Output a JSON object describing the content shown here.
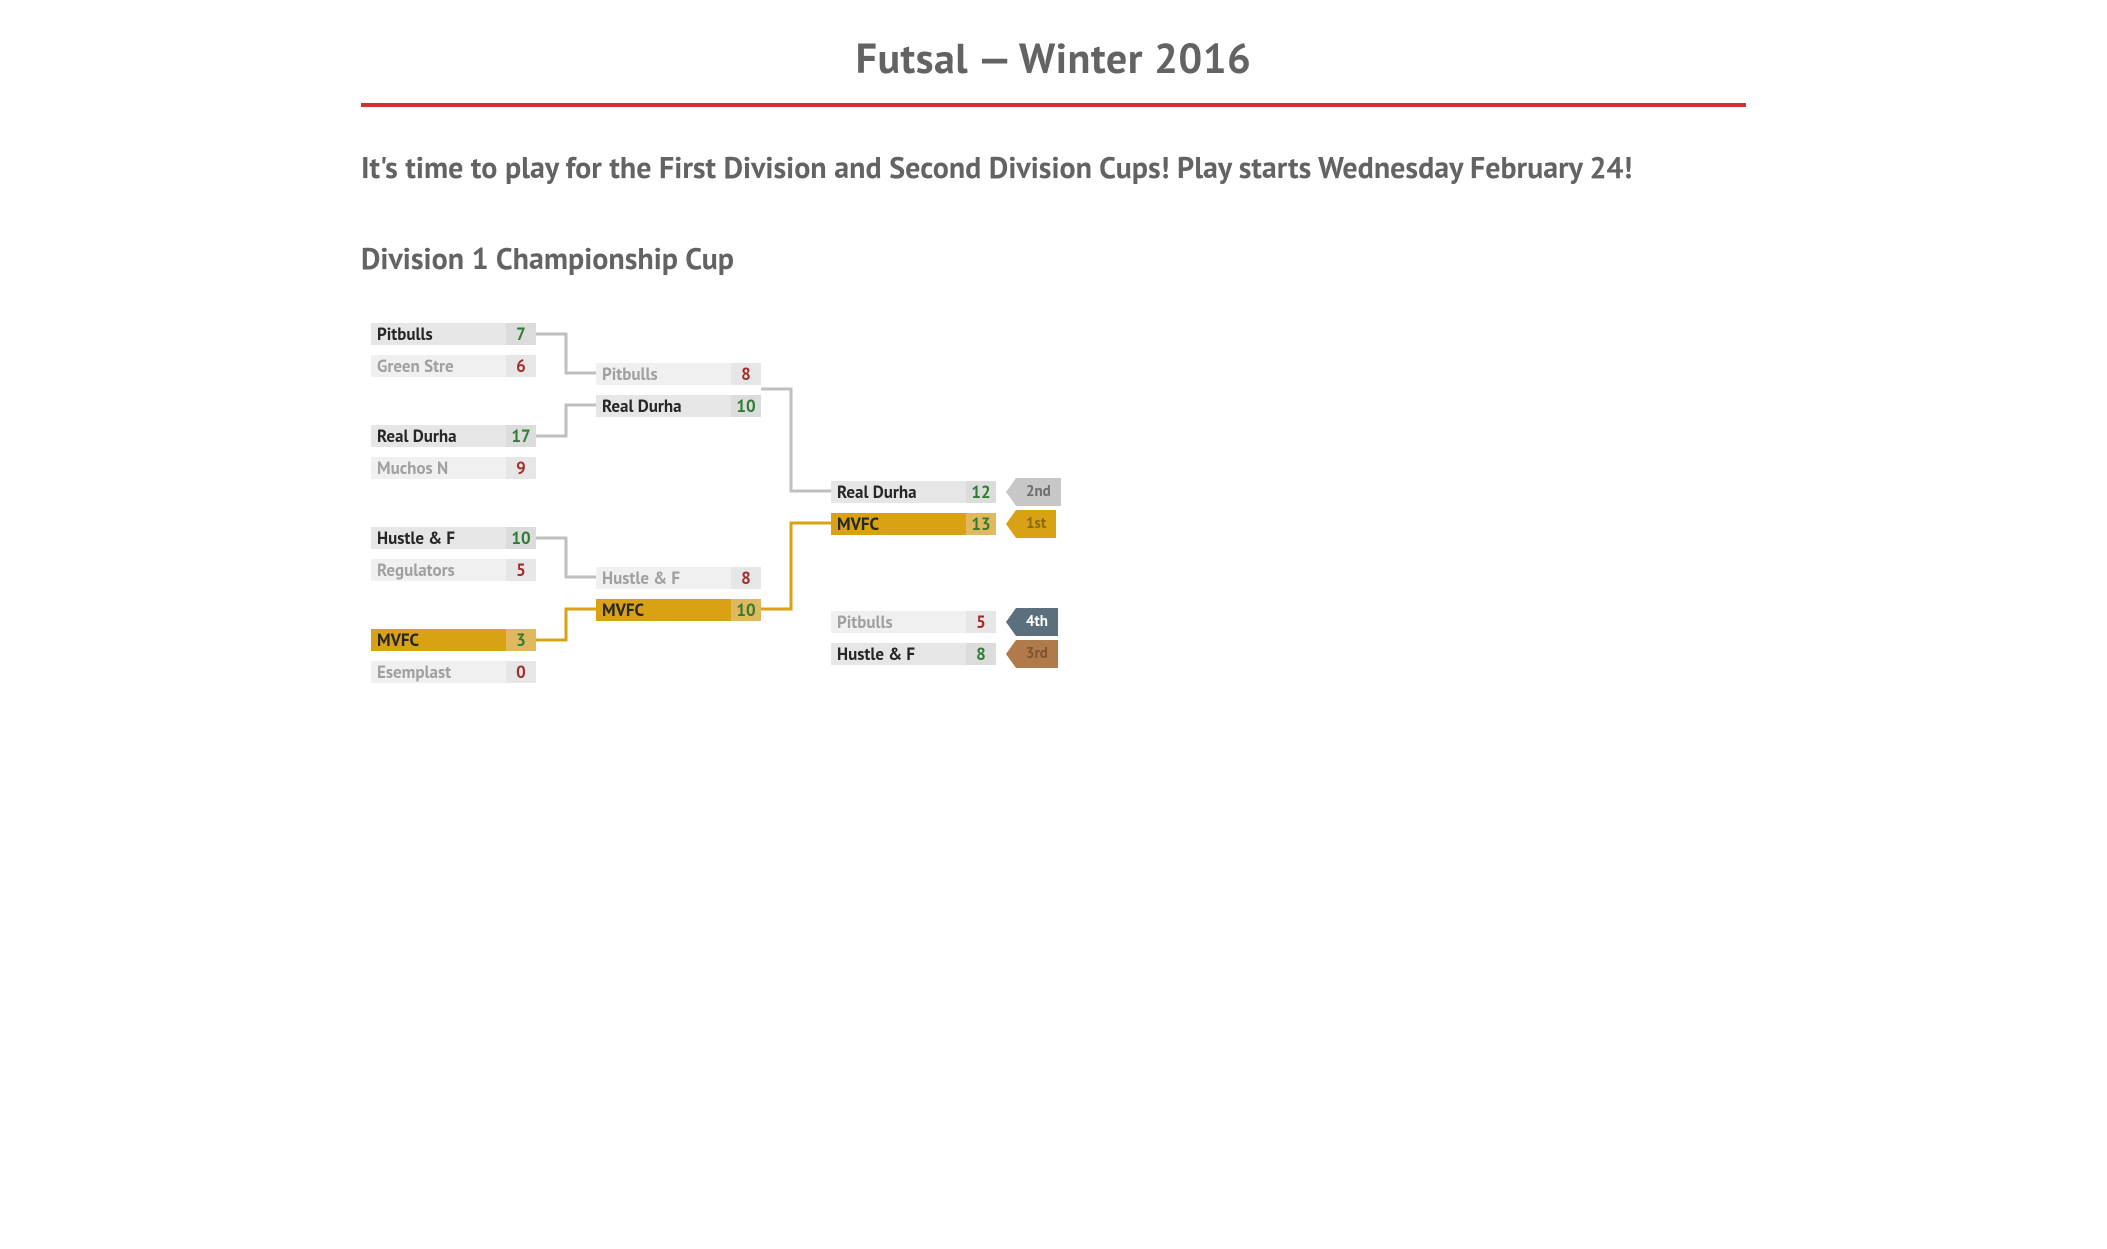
{
  "title": "Futsal — Winter 2016",
  "lead": "It's time to play for the First Division and Second Division Cups! Play starts Wednesday February 24!",
  "section": "Division 1 Championship Cup",
  "r1": [
    {
      "top": {
        "name": "Pitbulls",
        "score": "7",
        "win": true
      },
      "bot": {
        "name": "Green Stre",
        "score": "6",
        "win": false
      }
    },
    {
      "top": {
        "name": "Real Durha",
        "score": "17",
        "win": true
      },
      "bot": {
        "name": "Muchos N",
        "score": "9",
        "win": false
      }
    },
    {
      "top": {
        "name": "Hustle & F",
        "score": "10",
        "win": true
      },
      "bot": {
        "name": "Regulators",
        "score": "5",
        "win": false
      }
    },
    {
      "top": {
        "name": "MVFC",
        "score": "3",
        "win": true,
        "gold": true
      },
      "bot": {
        "name": "Esemplast",
        "score": "0",
        "win": false
      }
    }
  ],
  "r2": [
    {
      "top": {
        "name": "Pitbulls",
        "score": "8",
        "win": false
      },
      "bot": {
        "name": "Real Durha",
        "score": "10",
        "win": true
      }
    },
    {
      "top": {
        "name": "Hustle & F",
        "score": "8",
        "win": false
      },
      "bot": {
        "name": "MVFC",
        "score": "10",
        "win": true,
        "gold": true
      }
    }
  ],
  "final": {
    "top": {
      "name": "Real Durha",
      "score": "12",
      "win": false
    },
    "bot": {
      "name": "MVFC",
      "score": "13",
      "win": true,
      "gold": true
    }
  },
  "third": {
    "top": {
      "name": "Pitbulls",
      "score": "5",
      "win": false
    },
    "bot": {
      "name": "Hustle & F",
      "score": "8",
      "win": true
    }
  },
  "badges": {
    "first": "1st",
    "second": "2nd",
    "third": "3rd",
    "fourth": "4th"
  }
}
